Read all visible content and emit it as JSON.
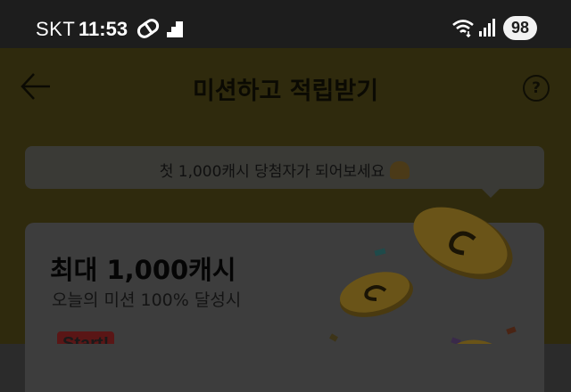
{
  "status_bar": {
    "carrier": "SKT",
    "time": "11:53",
    "battery": "98"
  },
  "header": {
    "title": "미션하고 적립받기",
    "help_label": "?"
  },
  "banner": {
    "text": "첫 1,000캐시 당첨자가 되어보세요"
  },
  "card": {
    "title": "최대 1,000캐시",
    "subtitle": "오늘의 미션 100% 달성시",
    "start_label": "Start!"
  },
  "colors": {
    "brand_yellow": "#f7d21e",
    "accent_red": "#e23b3b"
  }
}
